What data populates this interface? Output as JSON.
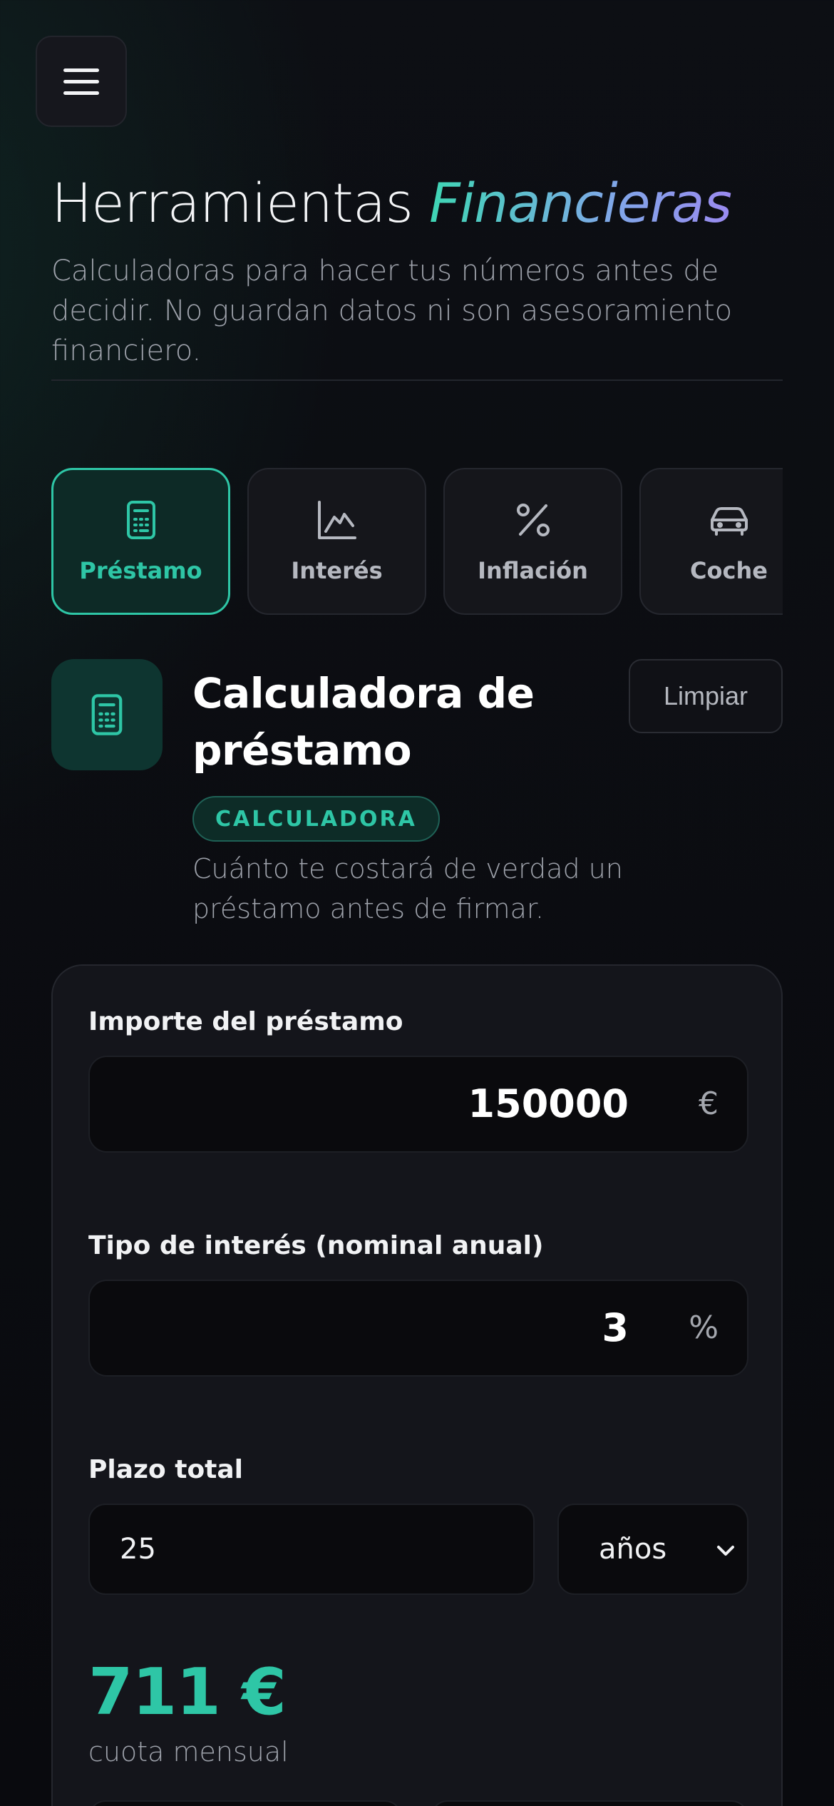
{
  "header": {
    "menu_icon": "hamburger-menu-icon",
    "title_main": "Herramientas ",
    "title_accent": "Financieras",
    "subtitle": "Calculadoras para hacer tus números antes de decidir. No guardan datos ni son asesoramiento financiero."
  },
  "tabs": [
    {
      "label": "Préstamo",
      "icon": "calculator-icon",
      "active": true
    },
    {
      "label": "Interés",
      "icon": "chart-icon",
      "active": false
    },
    {
      "label": "Inflación",
      "icon": "percent-icon",
      "active": false
    },
    {
      "label": "Coche",
      "icon": "car-icon",
      "active": false
    }
  ],
  "calculator": {
    "icon": "calculator-icon",
    "title": "Calculadora de préstamo",
    "reset_label": "Limpiar",
    "badge": "CALCULADORA",
    "description": "Cuánto te costará de verdad un préstamo antes de firmar."
  },
  "form": {
    "amount": {
      "label": "Importe del préstamo",
      "value": "150000",
      "unit": "€"
    },
    "interest": {
      "label": "Tipo de interés (nominal anual)",
      "value": "3",
      "unit": "%"
    },
    "term": {
      "label": "Plazo total",
      "value": "25",
      "unit_selected": "años"
    }
  },
  "result": {
    "value": "711 €",
    "label": "cuota mensual"
  },
  "colors": {
    "accent": "#2ec6a6",
    "background": "#0b0c10",
    "card": "#14151b"
  }
}
